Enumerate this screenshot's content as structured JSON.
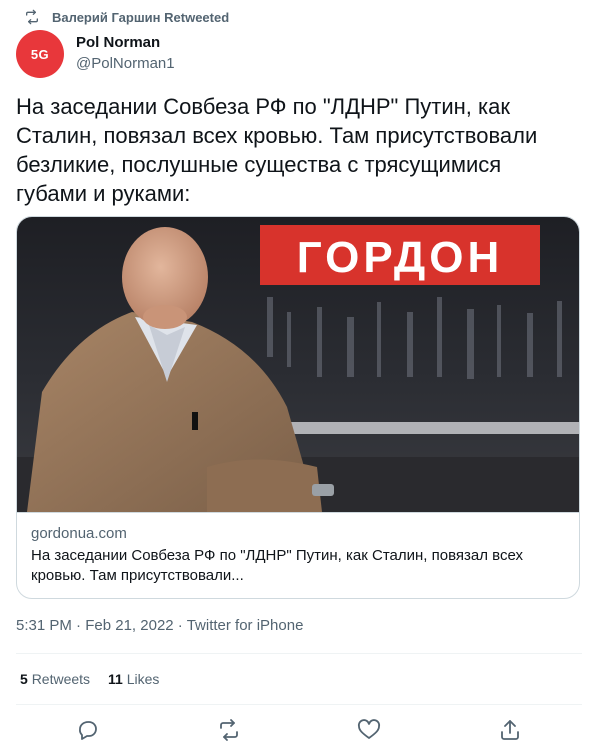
{
  "retweet": {
    "icon": "retweet-icon",
    "text": "Валерий Гаршин Retweeted"
  },
  "author": {
    "avatar_text": "5G",
    "avatar_color": "#e8373b",
    "name": "Pol Norman",
    "handle": "@PolNorman1"
  },
  "tweet": {
    "text": "На заседании Совбеза РФ по \"ЛДНР\" Путин, как Сталин, повязал всех кровью. Там присутствовали безликие, послушные существа с трясущимися губами и руками:"
  },
  "card": {
    "image_banner": "ГОРДОН",
    "domain": "gordonua.com",
    "title": "На заседании Совбеза РФ по \"ЛДНР\" Путин, как Сталин, повязал всех кровью. Там присутствовали..."
  },
  "meta": {
    "time": "5:31 PM",
    "separator1": " · ",
    "date": "Feb 21, 2022",
    "separator2": " · ",
    "source": "Twitter for iPhone"
  },
  "stats": {
    "retweets_count": "5",
    "retweets_label": "Retweets",
    "likes_count": "11",
    "likes_label": "Likes"
  },
  "actions": {
    "reply": "reply-icon",
    "retweet": "retweet-icon",
    "like": "like-icon",
    "share": "share-icon"
  },
  "colors": {
    "secondary_text": "#536471",
    "primary_text": "#0f1419",
    "border": "#cfd9de",
    "banner_red": "#d8332c"
  }
}
